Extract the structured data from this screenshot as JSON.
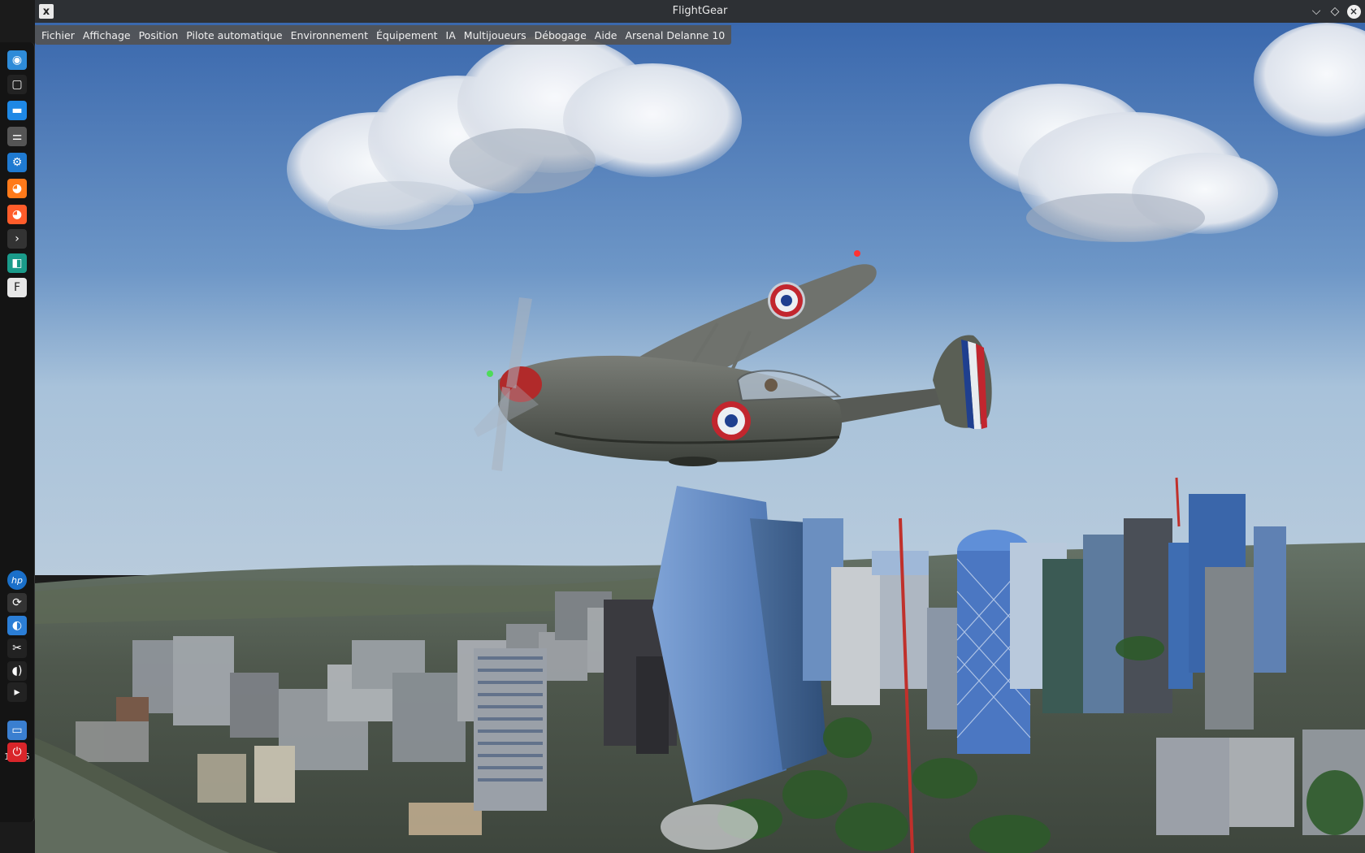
{
  "window": {
    "title": "FlightGear",
    "minimize_glyph": "⌵",
    "maximize_glyph": "◇",
    "close_glyph": "×"
  },
  "menubar": {
    "items": [
      {
        "label": "Fichier"
      },
      {
        "label": "Affichage"
      },
      {
        "label": "Position"
      },
      {
        "label": "Pilote automatique"
      },
      {
        "label": "Environnement"
      },
      {
        "label": "Équipement"
      },
      {
        "label": "IA"
      },
      {
        "label": "Multijoueurs"
      },
      {
        "label": "Débogage"
      },
      {
        "label": "Aide"
      },
      {
        "label": "Arsenal Delanne 10"
      }
    ]
  },
  "dock": {
    "clock": "19:15",
    "items": [
      {
        "name": "app-launcher-icon",
        "color": "#2e8bd8"
      },
      {
        "name": "show-desktop-icon",
        "color": "#222"
      },
      {
        "name": "file-manager-icon",
        "color": "#1e88e5"
      },
      {
        "name": "settings-icon",
        "color": "#555"
      },
      {
        "name": "system-settings-icon",
        "color": "#1f7ad1"
      },
      {
        "name": "firefox-icon",
        "color": "#ff7a1a"
      },
      {
        "name": "firefox-alt-icon",
        "color": "#ff5c2a"
      },
      {
        "name": "terminal-icon",
        "color": "#333"
      },
      {
        "name": "screenshot-icon",
        "color": "#1a9b8a"
      },
      {
        "name": "flightgear-icon",
        "color": "#e7e7e7"
      },
      {
        "name": "hp-icon",
        "color": "#1a6fc9"
      },
      {
        "name": "updates-icon",
        "color": "#333"
      },
      {
        "name": "network-icon",
        "color": "#2b7ed6"
      },
      {
        "name": "clipboard-icon",
        "color": "#222"
      },
      {
        "name": "volume-icon",
        "color": "#222"
      },
      {
        "name": "expand-tray-icon",
        "color": "#222"
      },
      {
        "name": "lock-screen-icon",
        "color": "#3a7fd0"
      },
      {
        "name": "power-icon",
        "color": "#d9252a"
      }
    ]
  },
  "colors": {
    "sky_top": "#3c6db2",
    "sky_horizon": "#a9c4dd",
    "ground": "#4b5148",
    "roundel_blue": "#1f3f8f",
    "roundel_red": "#c2262e"
  }
}
